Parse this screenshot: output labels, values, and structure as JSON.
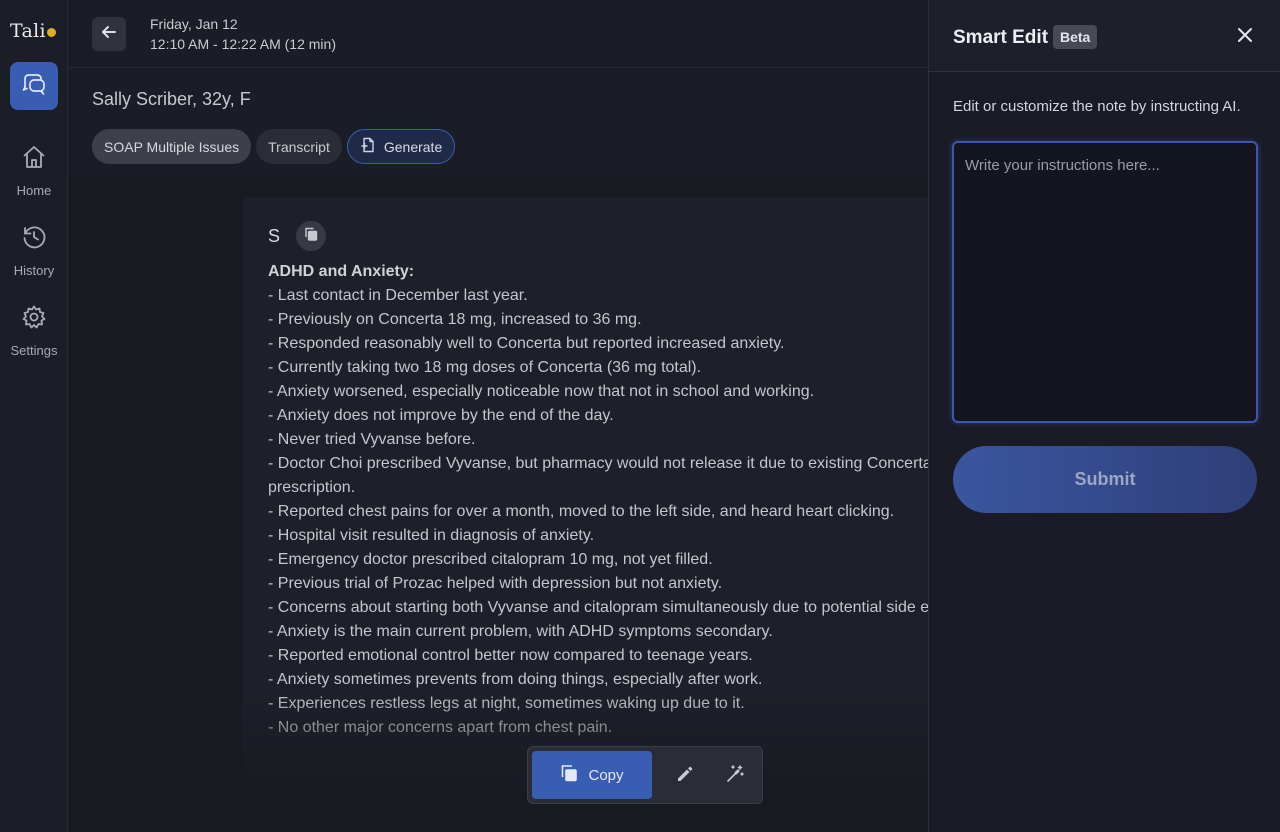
{
  "app": {
    "logo_text": "Tali"
  },
  "sidebar": {
    "items": [
      {
        "label": "Home",
        "icon": "home-icon"
      },
      {
        "label": "History",
        "icon": "history-icon"
      },
      {
        "label": "Settings",
        "icon": "gear-icon"
      }
    ]
  },
  "header": {
    "date": "Friday, Jan 12",
    "time_range": "12:10 AM - 12:22 AM (12 min)"
  },
  "patient": {
    "summary": "Sally Scriber, 32y, F"
  },
  "tabs": [
    {
      "label": "SOAP Multiple Issues",
      "active": true
    },
    {
      "label": "Transcript",
      "active": false
    },
    {
      "label": "Generate",
      "icon": "document-add-icon"
    }
  ],
  "note": {
    "section_letter": "S",
    "heading": "ADHD and Anxiety:",
    "lines": [
      "- Last contact in December last year.",
      "- Previously on Concerta 18 mg, increased to 36 mg.",
      "- Responded reasonably well to Concerta but reported increased anxiety.",
      "- Currently taking two 18 mg doses of Concerta (36 mg total).",
      "- Anxiety worsened, especially noticeable now that not in school and working.",
      "- Anxiety does not improve by the end of the day.",
      "- Never tried Vyvanse before.",
      "- Doctor Choi prescribed Vyvanse, but pharmacy would not release it due to existing Concerta",
      "prescription.",
      "- Reported chest pains for over a month, moved to the left side, and heard heart clicking.",
      "- Hospital visit resulted in diagnosis of anxiety.",
      "- Emergency doctor prescribed citalopram 10 mg, not yet filled.",
      "- Previous trial of Prozac helped with depression but not anxiety.",
      "- Concerns about starting both Vyvanse and citalopram simultaneously due to potential side effects.",
      "- Anxiety is the main current problem, with ADHD symptoms secondary.",
      "- Reported emotional control better now compared to teenage years.",
      "- Anxiety sometimes prevents from doing things, especially after work.",
      "- Experiences restless legs at night, sometimes waking up due to it.",
      "- No other major concerns apart from chest pain."
    ]
  },
  "toolbar": {
    "copy_label": "Copy"
  },
  "smart_edit": {
    "title": "Smart Edit",
    "badge": "Beta",
    "description": "Edit or customize the note by instructing AI.",
    "placeholder": "Write your instructions here...",
    "value": "",
    "submit_label": "Submit"
  },
  "colors": {
    "accent": "#3a5db4",
    "logo_dot": "#e0b020",
    "focus_border": "#3b58b0"
  }
}
